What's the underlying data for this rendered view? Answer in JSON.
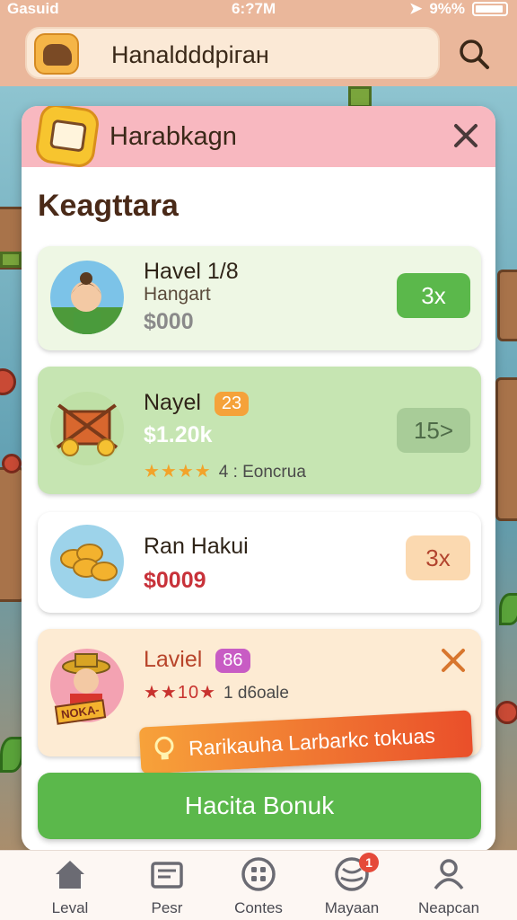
{
  "status_bar": {
    "carrier": "Gasuid",
    "time": "6:?7M",
    "battery": "9%%"
  },
  "header": {
    "title": "Hanaldddpiган"
  },
  "modal": {
    "title": "Harabkagn",
    "section_title": "Keagttara",
    "items": [
      {
        "name": "Havel 1/8",
        "subtitle": "Hangart",
        "price": "$000",
        "multiplier": "3x"
      },
      {
        "name": "Nayel",
        "tag": "23",
        "price": "$1.20k",
        "stars": "★★★★",
        "rating_note": "4 : Eoncrua",
        "multiplier": "15>"
      },
      {
        "name": "Ran Hakui",
        "price": "$0009",
        "multiplier": "3x"
      },
      {
        "name": "Laviel",
        "tag": "86",
        "stars": "★★10★",
        "rating_note": "1 d6oale",
        "avatar_label": "NOKA-"
      }
    ],
    "toast": "Rarikauha Larbarkc tokuas",
    "bonus_button": "Hacita Bonuk"
  },
  "bottom_nav": [
    {
      "label": "Leval",
      "icon": "home-icon"
    },
    {
      "label": "Pesr",
      "icon": "store-icon"
    },
    {
      "label": "Contes",
      "icon": "grid-icon"
    },
    {
      "label": "Mayaan",
      "icon": "globe-icon",
      "badge": "1"
    },
    {
      "label": "Neapcan",
      "icon": "profile-icon"
    }
  ],
  "colors": {
    "header_bg": "#eab79b",
    "modal_head_bg": "#f8b8c0",
    "green_button": "#5bb84b",
    "price_red": "#c8323a",
    "toast_orange": "#ea4f2a"
  }
}
